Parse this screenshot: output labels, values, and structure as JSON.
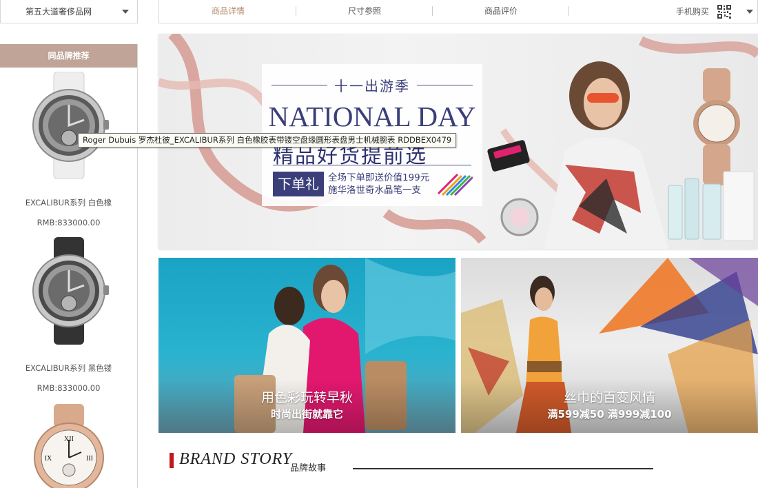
{
  "site_select": {
    "label": "第五大道奢侈品网"
  },
  "tabs": [
    {
      "label": "商品详情"
    },
    {
      "label": "尺寸参照"
    },
    {
      "label": "商品评价"
    }
  ],
  "mobile_buy": {
    "label": "手机购买",
    "icon": "qr-code-icon"
  },
  "sidebar": {
    "title": "同品牌推荐",
    "products": [
      {
        "name": "EXCALIBUR系列 白色橡",
        "price": "RMB:833000.00",
        "dial": "silver",
        "strap": "white"
      },
      {
        "name": "EXCALIBUR系列 黑色镂",
        "price": "RMB:833000.00",
        "dial": "silver",
        "strap": "black"
      },
      {
        "name": "",
        "price": "",
        "dial": "white-roman",
        "strap": "rose-gold"
      }
    ]
  },
  "tooltip": {
    "text": "Roger Dubuis 罗杰杜彼_EXCALIBUR系列 白色橡胶表带镂空盘缘圆形表盘男士机械腕表   RDDBEX0479"
  },
  "hero": {
    "event": "十一出游季",
    "headline": "NATIONAL DAY",
    "subline": "精品好货提前选",
    "gift_label": "下单礼",
    "gift_line1": "全场下单即送价值199元",
    "gift_line2": "施华洛世奇水晶笔一支"
  },
  "tiles": [
    {
      "title": "用色彩玩转早秋",
      "subtitle": "时尚出街就靠它"
    },
    {
      "title": "丝巾的百变风情",
      "subtitle": "满599减50 满999减100"
    }
  ],
  "brand_story": {
    "title": "BRAND STORY",
    "subtitle": "品牌故事"
  },
  "colors": {
    "accent": "#b38a6e",
    "sidebar_head": "#bfa497",
    "promo_navy": "#3a3f7a",
    "brand_red": "#c4161c"
  }
}
